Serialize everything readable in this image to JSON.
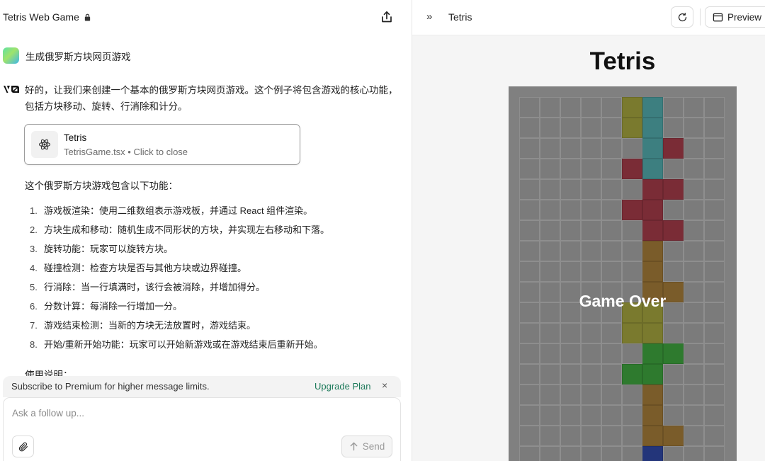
{
  "header": {
    "title": "Tetris Web Game",
    "lock_icon": "lock-icon",
    "share_icon": "share-icon"
  },
  "chat": {
    "user_message": "生成俄罗斯方块网页游戏",
    "assistant_logo": "v0",
    "assistant_intro": "好的，让我们来创建一个基本的俄罗斯方块网页游戏。这个例子将包含游戏的核心功能，包括方块移动、旋转、行消除和计分。",
    "artifact": {
      "title": "Tetris",
      "subtitle": "TetrisGame.tsx • Click to close",
      "icon": "react-atom-icon"
    },
    "features_title": "这个俄罗斯方块游戏包含以下功能：",
    "features": [
      {
        "num": "1.",
        "text": "游戏板渲染：使用二维数组表示游戏板，并通过 React 组件渲染。"
      },
      {
        "num": "2.",
        "text": "方块生成和移动：随机生成不同形状的方块，并实现左右移动和下落。"
      },
      {
        "num": "3.",
        "text": "旋转功能：玩家可以旋转方块。"
      },
      {
        "num": "4.",
        "text": "碰撞检测：检查方块是否与其他方块或边界碰撞。"
      },
      {
        "num": "5.",
        "text": "行消除：当一行填满时，该行会被消除，并增加得分。"
      },
      {
        "num": "6.",
        "text": "分数计算：每消除一行增加一分。"
      },
      {
        "num": "7.",
        "text": "游戏结束检测：当新的方块无法放置时，游戏结束。"
      },
      {
        "num": "8.",
        "text": "开始/重新开始功能：玩家可以开始新游戏或在游戏结束后重新开始。"
      }
    ],
    "usage_title": "使用说明："
  },
  "banner": {
    "text": "Subscribe to Premium for higher message limits.",
    "upgrade_label": "Upgrade Plan",
    "close_label": "×"
  },
  "composer": {
    "placeholder": "Ask a follow up...",
    "send_label": "Send"
  },
  "preview_panel": {
    "title": "Tetris",
    "preview_label": "Preview",
    "game_title": "Tetris",
    "game_over": "Game Over"
  },
  "colors": {
    "olive": "#7a7a2e",
    "teal": "#3d7f80",
    "crimson": "#7a2c36",
    "brown": "#7a5c2a",
    "green": "#2e7a2e",
    "navy": "#23357a",
    "empty": "#7b7b7b",
    "accent_link": "#1d7a5a"
  },
  "board": {
    "cols": 10,
    "filled": [
      {
        "row": 0,
        "col": 5,
        "color": "olive"
      },
      {
        "row": 0,
        "col": 6,
        "color": "teal"
      },
      {
        "row": 1,
        "col": 5,
        "color": "olive"
      },
      {
        "row": 1,
        "col": 6,
        "color": "teal"
      },
      {
        "row": 2,
        "col": 6,
        "color": "teal"
      },
      {
        "row": 2,
        "col": 7,
        "color": "crimson"
      },
      {
        "row": 3,
        "col": 5,
        "color": "crimson"
      },
      {
        "row": 3,
        "col": 6,
        "color": "teal"
      },
      {
        "row": 4,
        "col": 6,
        "color": "crimson"
      },
      {
        "row": 4,
        "col": 7,
        "color": "crimson"
      },
      {
        "row": 5,
        "col": 5,
        "color": "crimson"
      },
      {
        "row": 5,
        "col": 6,
        "color": "crimson"
      },
      {
        "row": 6,
        "col": 6,
        "color": "crimson"
      },
      {
        "row": 6,
        "col": 7,
        "color": "crimson"
      },
      {
        "row": 7,
        "col": 6,
        "color": "brown"
      },
      {
        "row": 8,
        "col": 6,
        "color": "brown"
      },
      {
        "row": 9,
        "col": 6,
        "color": "brown"
      },
      {
        "row": 9,
        "col": 7,
        "color": "brown"
      },
      {
        "row": 10,
        "col": 5,
        "color": "olive"
      },
      {
        "row": 10,
        "col": 6,
        "color": "olive"
      },
      {
        "row": 11,
        "col": 5,
        "color": "olive"
      },
      {
        "row": 11,
        "col": 6,
        "color": "olive"
      },
      {
        "row": 12,
        "col": 6,
        "color": "green"
      },
      {
        "row": 12,
        "col": 7,
        "color": "green"
      },
      {
        "row": 13,
        "col": 5,
        "color": "green"
      },
      {
        "row": 13,
        "col": 6,
        "color": "green"
      },
      {
        "row": 14,
        "col": 6,
        "color": "brown"
      },
      {
        "row": 15,
        "col": 6,
        "color": "brown"
      },
      {
        "row": 16,
        "col": 6,
        "color": "brown"
      },
      {
        "row": 16,
        "col": 7,
        "color": "brown"
      },
      {
        "row": 17,
        "col": 6,
        "color": "navy"
      }
    ]
  }
}
